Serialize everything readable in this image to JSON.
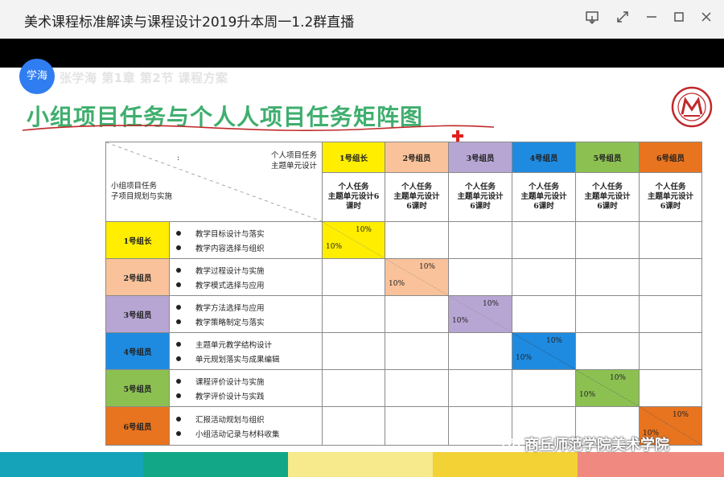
{
  "window": {
    "title": "美术课程标准解读与课程设计2019升本周一1.2群直播"
  },
  "window_controls": [
    "share-screen",
    "expand",
    "minimize",
    "maximize",
    "close"
  ],
  "slide": {
    "badge": "学海",
    "lesson": "张学海 第1章 第2节 课程方案",
    "title": "小组项目任务与个人人项目任务矩阵图",
    "corner": {
      "top_line1": "个人项目任务",
      "top_line2": "主题单元设计",
      "colon": ":",
      "left_line1": "小组项目任务",
      "left_line2": "子项目规划与实施"
    },
    "columns": [
      {
        "label": "1号组长",
        "color": "#ffee00"
      },
      {
        "label": "2号组员",
        "color": "#f9c29a"
      },
      {
        "label": "3号组员",
        "color": "#b7a6d3"
      },
      {
        "label": "4号组员",
        "color": "#1f8be0"
      },
      {
        "label": "5号组员",
        "color": "#8cc152"
      },
      {
        "label": "6号组员",
        "color": "#e8741f"
      }
    ],
    "subheaders": [
      {
        "l1": "个人任务",
        "l2": "主题单元设计6",
        "l3": "课时"
      },
      {
        "l1": "个人任务",
        "l2": "主题单元设计",
        "l3": "6课时"
      },
      {
        "l1": "个人任务",
        "l2": "主题单元设计",
        "l3": "6课时"
      },
      {
        "l1": "个人任务",
        "l2": "主题单元设计",
        "l3": "6课时"
      },
      {
        "l1": "个人任务",
        "l2": "主题单元设计",
        "l3": "6课时"
      },
      {
        "l1": "个人任务",
        "l2": "主题单元设计",
        "l3": "6课时"
      }
    ],
    "rows": [
      {
        "label": "1号组长",
        "tasks": [
          "教学目标设计与落实",
          "教学内容选择与组织"
        ]
      },
      {
        "label": "2号组员",
        "tasks": [
          "教学过程设计与实施",
          "教学模式选择与应用"
        ]
      },
      {
        "label": "3号组员",
        "tasks": [
          "教学方法选择与应用",
          "教学策略制定与落实"
        ]
      },
      {
        "label": "4号组员",
        "tasks": [
          "主题单元教学结构设计",
          "单元规划落实与成果编辑"
        ]
      },
      {
        "label": "5号组员",
        "tasks": [
          "课程评价设计与实施",
          "教学评价设计与实践"
        ]
      },
      {
        "label": "6号组员",
        "tasks": [
          "汇报活动规划与组织",
          "小组活动记录与材料收集"
        ]
      }
    ],
    "diag_pct_a": "10%",
    "diag_pct_b": "10%",
    "watermark": "商丘师范学院美术学院"
  },
  "bottom_bar_colors": [
    "#14a3b8",
    "#11a787",
    "#f6ea8c",
    "#f2d234",
    "#f08a80"
  ]
}
